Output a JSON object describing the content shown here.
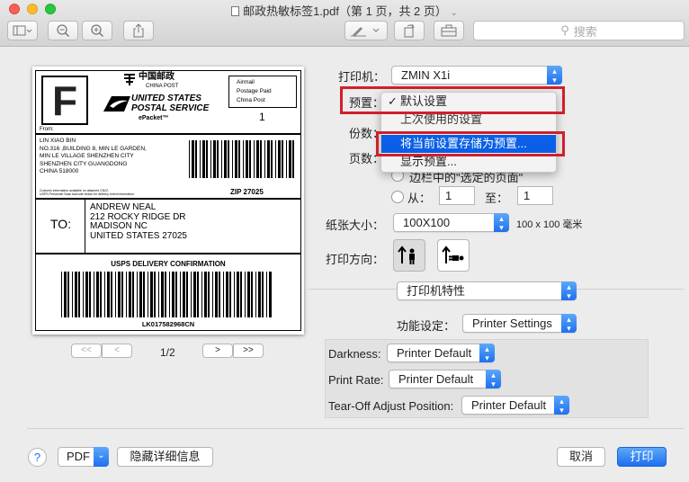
{
  "window": {
    "title": "邮政热敏标签1.pdf（第 1 页，共 2 页）",
    "search_placeholder": "搜索"
  },
  "preview": {
    "page_indicator": "1/2",
    "label": {
      "service_letter": "F",
      "china_post_cn": "中国邮政",
      "china_post_en": "CHINA POST",
      "usps_line1": "UNITED STATES",
      "usps_line2": "POSTAL SERVICE",
      "epacket": "ePacket™",
      "airmail_box": "Airmail\nPostage Paid\nChina Post",
      "from": "From:",
      "count": "1",
      "sender": "LIN XIAO BIN\nNO.316 ,BUILDING 8, MIN LE GARDEN,\nMIN LE VILLAGE SHENZHEN CITY\nSHENZHEN CITY GUANGDONG\nCHINA 518000",
      "customs_note": "Customs information available on attached CN22.\nUSPS Personnel Scan barcode below for delivery event information",
      "zip": "ZIP 27025",
      "to_label": "TO:",
      "recipient": "ANDREW NEAL\n212 ROCKY RIDGE DR\nMADISON NC\nUNITED STATES 27025",
      "confirmation": "USPS DELIVERY CONFIRMATION",
      "tracking": "LK017582968CN"
    }
  },
  "form": {
    "printer_label": "打印机：",
    "printer_value": "ZMIN X1i",
    "preset_label": "预置：",
    "copies_label": "份数：",
    "pages_label": "页数：",
    "pages_option": "边栏中的\"选定的页面\"",
    "from_label": "从：",
    "from_value": "1",
    "to_label": "至：",
    "to_value": "1",
    "paper_label": "纸张大小：",
    "paper_value": "100X100",
    "paper_desc": "100 x 100 毫米",
    "orientation_label": "打印方向：",
    "section_value": "打印机特性",
    "feature_label": "功能设定：",
    "feature_value": "Printer Settings",
    "darkness_label": "Darkness:",
    "darkness_value": "Printer Default",
    "rate_label": "Print Rate:",
    "rate_value": "Printer Default",
    "tearoff_label": "Tear-Off Adjust Position:",
    "tearoff_value": "Printer Default"
  },
  "menu": {
    "items": [
      "默认设置",
      "上次使用的设置",
      "将当前设置存储为预置...",
      "显示预置..."
    ],
    "checkmark": "✓"
  },
  "footer": {
    "help": "?",
    "pdf": "PDF",
    "hide_details": "隐藏详细信息",
    "cancel": "取消",
    "print": "打印"
  },
  "colors": {
    "accent": "#1e6ff0",
    "highlight": "#0a5fe6",
    "annotation_red": "#d0202a"
  }
}
